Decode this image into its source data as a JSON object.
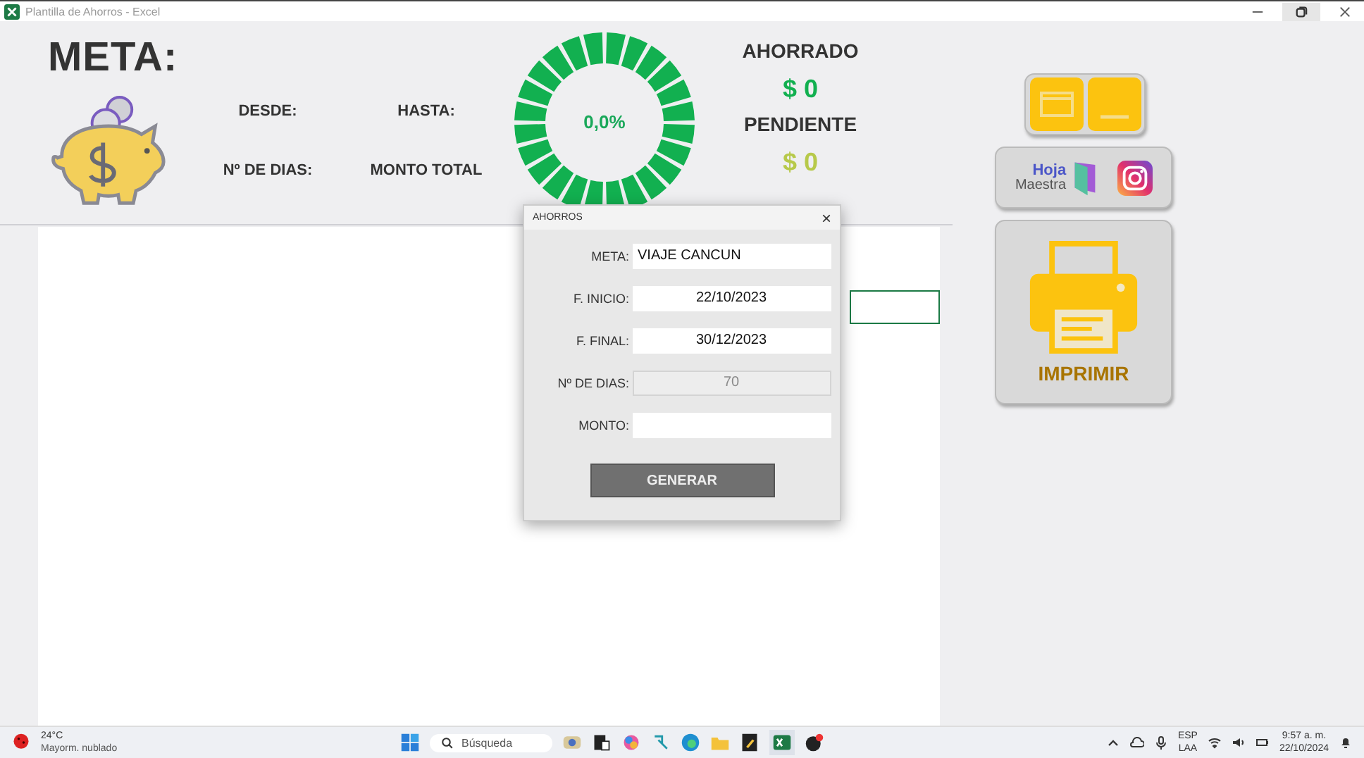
{
  "window": {
    "title": "Plantilla de Ahorros - Excel"
  },
  "header": {
    "title": "META:",
    "labels": [
      "DESDE:",
      "HASTA:",
      "Nº DE DIAS:",
      "MONTO TOTAL"
    ],
    "progress": "0,0%",
    "saved_label": "AHORRADO",
    "saved_value": "$ 0",
    "pending_label": "PENDIENTE",
    "pending_value": "$ 0"
  },
  "side_buttons": {
    "brand_top": "Hoja",
    "brand_bottom": "Maestra",
    "print": "IMPRIMIR"
  },
  "dialog": {
    "title": "AHORROS",
    "close": "×",
    "fields": [
      {
        "label": "META:",
        "value": "VIAJE CANCUN",
        "kind": "text",
        "disabled": false
      },
      {
        "label": "F. INICIO:",
        "value": "22/10/2023",
        "kind": "date",
        "disabled": false
      },
      {
        "label": "F. FINAL:",
        "value": "30/12/2023",
        "kind": "date",
        "disabled": false
      },
      {
        "label": "Nº DE DIAS:",
        "value": "70",
        "kind": "number",
        "disabled": true
      },
      {
        "label": "MONTO:",
        "kind": "number",
        "disabled": false
      }
    ],
    "button": "GENERAR"
  },
  "taskbar": {
    "temperature": "24°C",
    "weather": "Mayorm. nublado",
    "search_placeholder": "Búsqueda",
    "language_top": "ESP",
    "language_bottom": "LAA",
    "time": "9:57 a. m.",
    "date": "22/10/2024"
  }
}
